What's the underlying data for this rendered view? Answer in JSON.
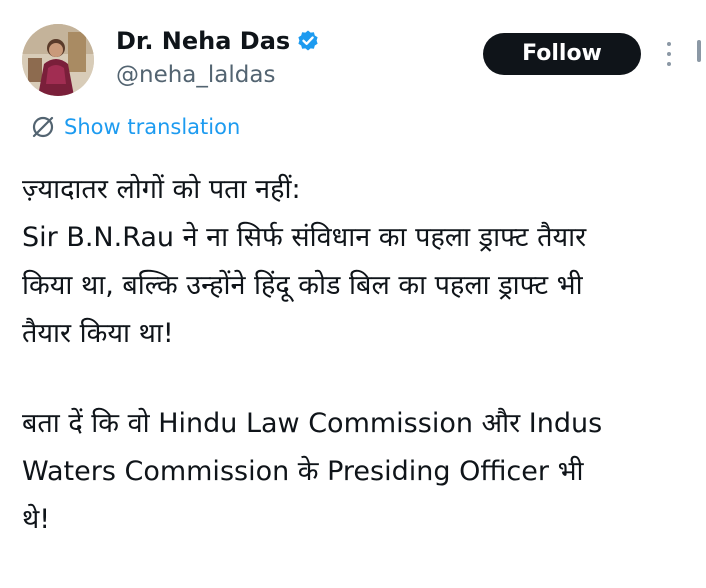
{
  "author": {
    "display_name": "Dr. Neha Das",
    "handle": "@neha_laldas",
    "verified_icon": "verified-badge-icon"
  },
  "actions": {
    "follow_label": "Follow",
    "more_icon": "more-vertical-icon"
  },
  "translation": {
    "label": "Show translation",
    "icon": "translate-icon"
  },
  "tweet": {
    "lines": [
      "ज़्यादातर लोगों को पता नहीं:",
      "Sir B.N.Rau ने ना सिर्फ संविधान का पहला ड्राफ्ट तैयार",
      "किया था, बल्कि उन्होंने हिंदू कोड बिल का पहला ड्राफ्ट भी",
      "तैयार किया था!",
      "बता दें कि वो Hindu Law Commission और Indus",
      "Waters Commission के Presiding Officer भी",
      "थे!"
    ]
  },
  "colors": {
    "text": "#0f1419",
    "secondary": "#536471",
    "accent": "#1d9bf0",
    "button_bg": "#0f1419",
    "button_text": "#ffffff"
  }
}
